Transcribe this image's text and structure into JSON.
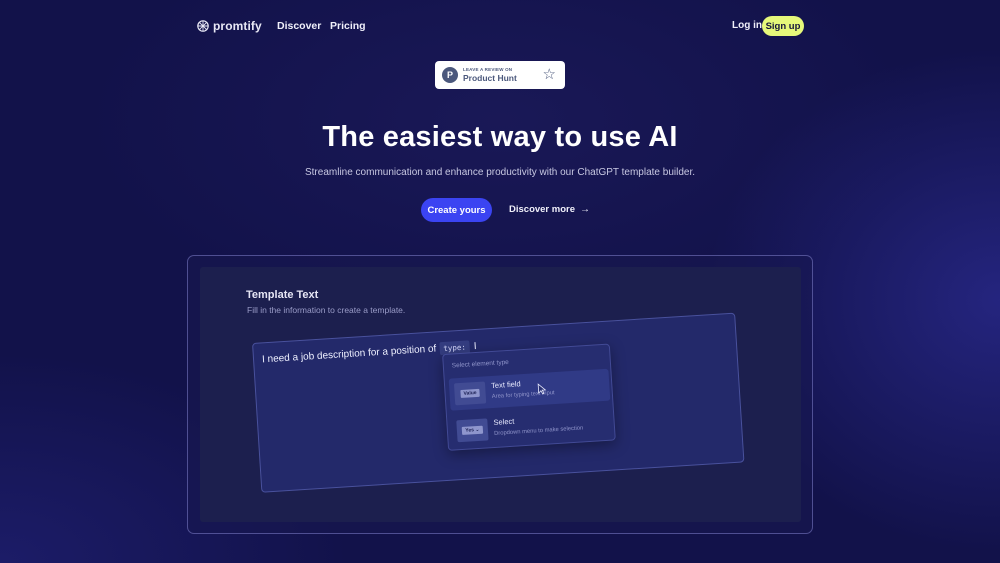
{
  "nav": {
    "logo_text": "promtify",
    "links": [
      "Discover",
      "Pricing"
    ],
    "login": "Log in",
    "signup": "Sign up"
  },
  "product_hunt": {
    "small_text": "LEAVE A REVIEW ON",
    "big_text": "Product Hunt",
    "logo_letter": "P"
  },
  "hero": {
    "title": "The easiest way to use AI",
    "subtitle": "Streamline communication and enhance productivity with our ChatGPT template builder.",
    "primary_cta": "Create yours",
    "secondary_cta": "Discover more"
  },
  "preview": {
    "title": "Template Text",
    "subtitle": "Fill in the information to create a template.",
    "prompt_text": "I need a job description for a position of",
    "type_chip": "type:",
    "caret": "I",
    "dropdown": {
      "header": "Select element type",
      "items": [
        {
          "name": "Text field",
          "description": "Area for typing text input",
          "thumb": "Value"
        },
        {
          "name": "Select",
          "description": "Dropdown menu to make selection",
          "thumb": "Yes ⌄"
        }
      ]
    }
  },
  "colors": {
    "background": "#12124a",
    "accent": "#3b44f2",
    "signup": "#e6f87a"
  }
}
